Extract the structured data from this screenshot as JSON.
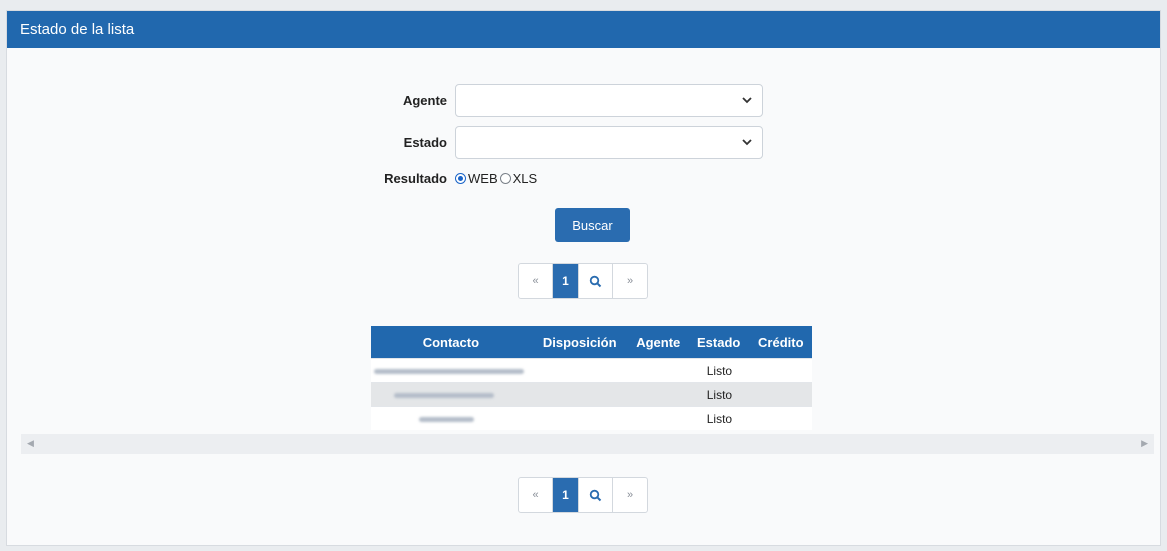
{
  "panel": {
    "title": "Estado de la lista"
  },
  "form": {
    "agente": {
      "label": "Agente",
      "value": ""
    },
    "estado": {
      "label": "Estado",
      "value": ""
    },
    "resultado": {
      "label": "Resultado",
      "options": [
        "WEB",
        "XLS"
      ],
      "selected": "WEB"
    },
    "search_button": "Buscar"
  },
  "pagination": {
    "prev": "«",
    "current": "1",
    "next": "»",
    "search_icon": "magnifier-icon"
  },
  "table": {
    "columns": [
      "Contacto",
      "Disposición",
      "Agente",
      "Estado",
      "Crédito"
    ],
    "rows": [
      {
        "contacto": "",
        "disposicion": "",
        "agente": "",
        "estado": "Listo",
        "credito": ""
      },
      {
        "contacto": "",
        "disposicion": "",
        "agente": "",
        "estado": "Listo",
        "credito": ""
      },
      {
        "contacto": "",
        "disposicion": "",
        "agente": "",
        "estado": "Listo",
        "credito": ""
      }
    ]
  },
  "colors": {
    "header": "#2168ae",
    "primary": "#2a6cb0",
    "background": "#f9fafb"
  }
}
